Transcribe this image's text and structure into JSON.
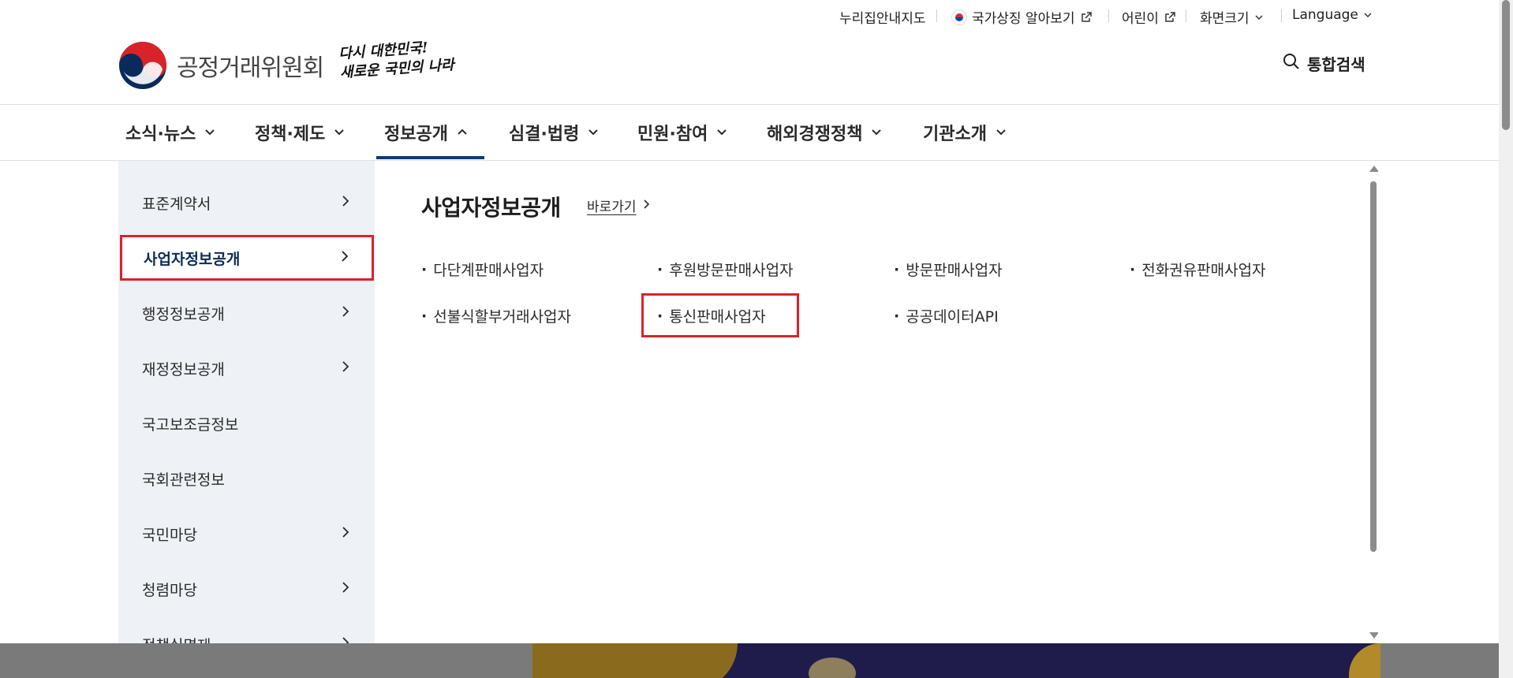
{
  "utility_bar": {
    "items": [
      {
        "label": "누리집안내지도"
      },
      {
        "label": "국가상징 알아보기"
      },
      {
        "label": "어린이"
      },
      {
        "label": "화면크기"
      },
      {
        "label": "Language"
      }
    ]
  },
  "header": {
    "org_name": "공정거래위원회",
    "slogan_line1": "다시 대한민국!",
    "slogan_line2": "새로운 국민의 나라",
    "search_label": "통합검색"
  },
  "gnb": {
    "items": [
      {
        "label": "소식·뉴스",
        "expanded": false
      },
      {
        "label": "정책·제도",
        "expanded": false
      },
      {
        "label": "정보공개",
        "expanded": true
      },
      {
        "label": "심결·법령",
        "expanded": false
      },
      {
        "label": "민원·참여",
        "expanded": false
      },
      {
        "label": "해외경쟁정책",
        "expanded": false
      },
      {
        "label": "기관소개",
        "expanded": false
      }
    ]
  },
  "sidebar": {
    "items": [
      {
        "label": "표준계약서",
        "has_arrow": true
      },
      {
        "label": "사업자정보공개",
        "has_arrow": true,
        "active": true
      },
      {
        "label": "행정정보공개",
        "has_arrow": true
      },
      {
        "label": "재정정보공개",
        "has_arrow": true
      },
      {
        "label": "국고보조금정보",
        "has_arrow": false
      },
      {
        "label": "국회관련정보",
        "has_arrow": false
      },
      {
        "label": "국민마당",
        "has_arrow": true
      },
      {
        "label": "청렴마당",
        "has_arrow": true
      },
      {
        "label": "정책실명제",
        "has_arrow": true
      }
    ]
  },
  "content": {
    "title": "사업자정보공개",
    "go_link": "바로가기",
    "links": [
      {
        "label": "다단계판매사업자"
      },
      {
        "label": "후원방문판매사업자"
      },
      {
        "label": "방문판매사업자"
      },
      {
        "label": "전화권유판매사업자"
      },
      {
        "label": "선불식할부거래사업자"
      },
      {
        "label": "통신판매사업자"
      },
      {
        "label": "공공데이터API"
      }
    ]
  },
  "colors": {
    "accent_navy": "#0b3b72",
    "highlight_red": "#d8232a",
    "sidebar_bg": "#eef1f6"
  }
}
